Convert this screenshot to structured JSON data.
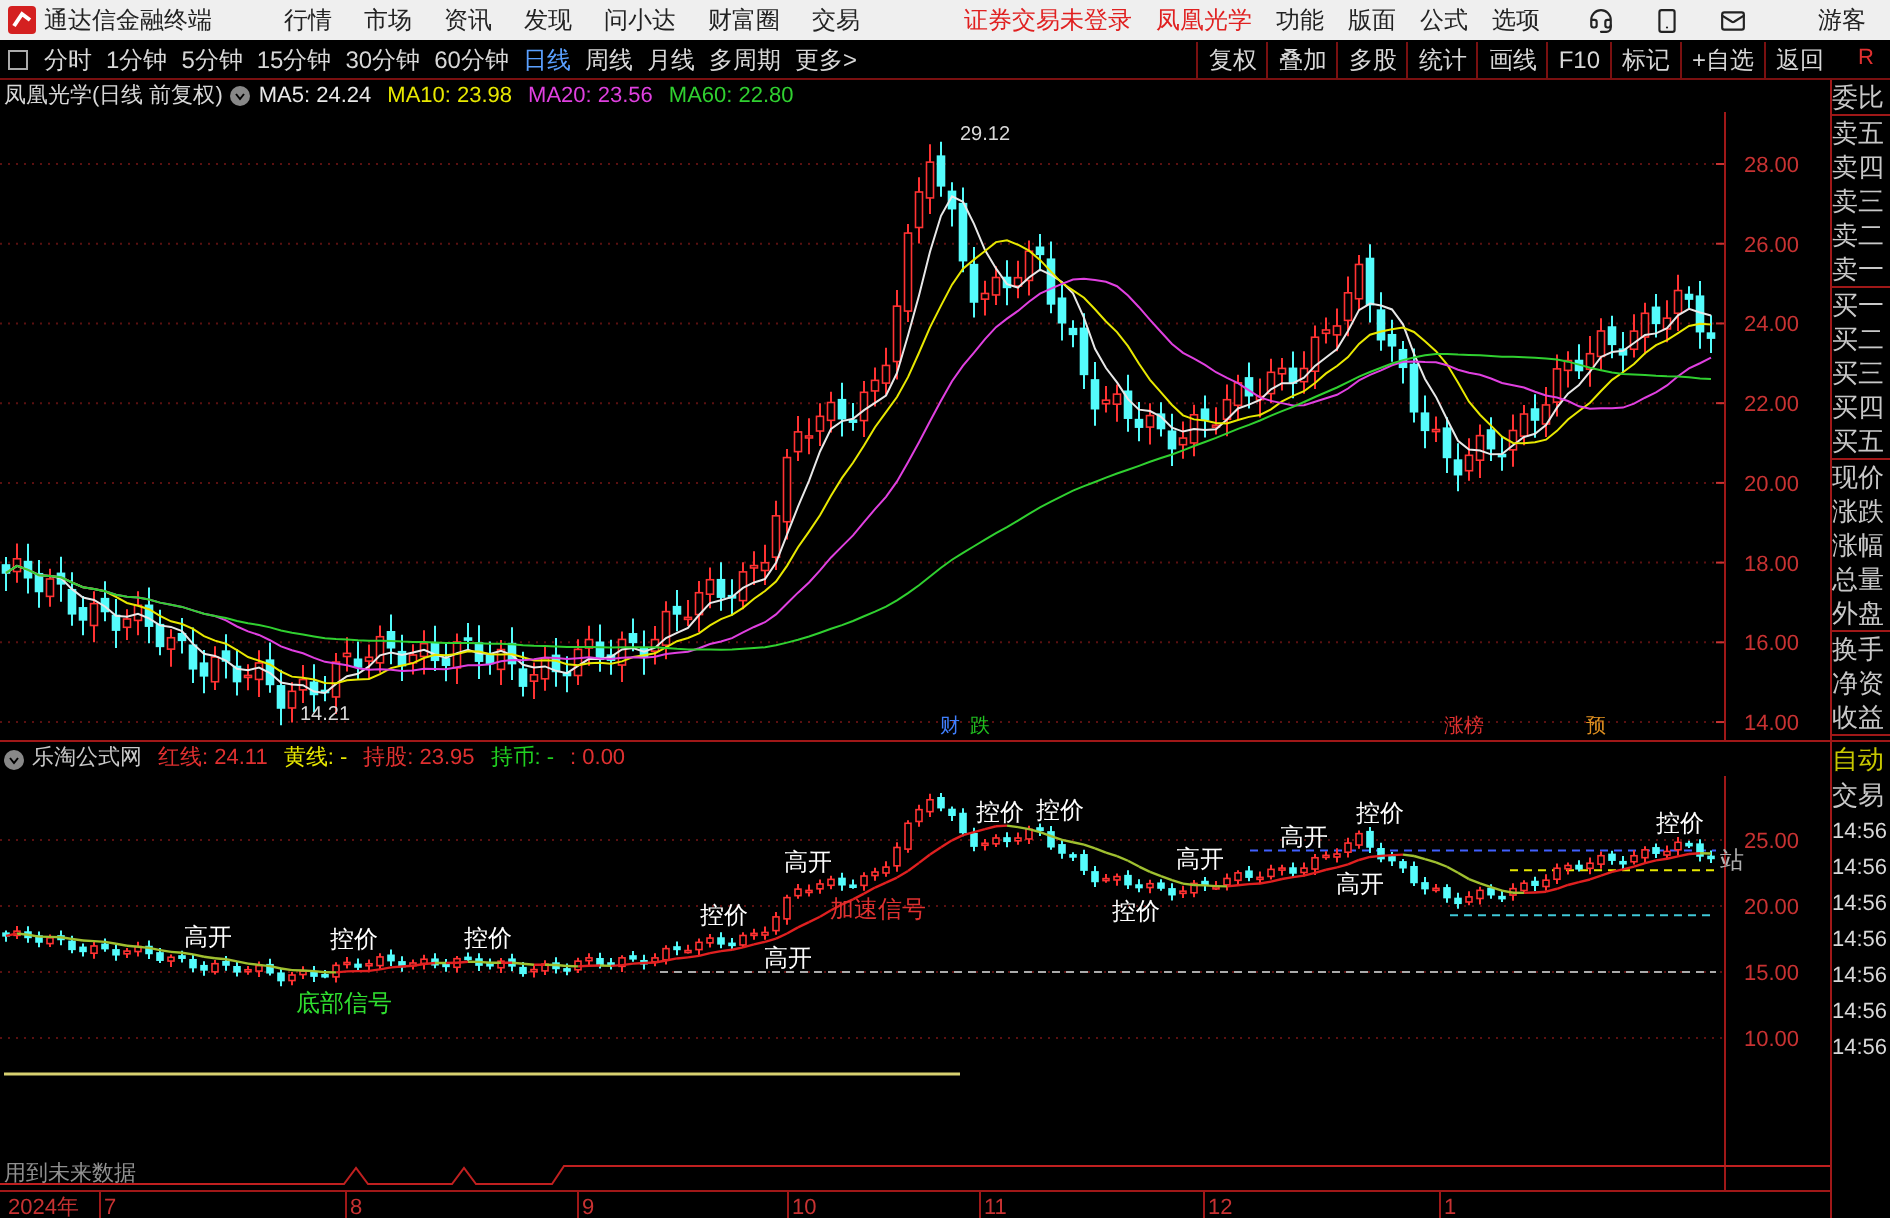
{
  "app_bar": {
    "title": "通达信金融终端",
    "menus": [
      "行情",
      "市场",
      "资讯",
      "发现",
      "问小达",
      "财富圈",
      "交易"
    ],
    "notices": [
      "证券交易未登录",
      "凤凰光学"
    ],
    "right_menus": [
      "功能",
      "版面",
      "公式",
      "选项"
    ],
    "user": "游客"
  },
  "toolbar": {
    "periods": [
      {
        "label": "分时",
        "selected": false
      },
      {
        "label": "1分钟",
        "selected": false
      },
      {
        "label": "5分钟",
        "selected": false
      },
      {
        "label": "15分钟",
        "selected": false
      },
      {
        "label": "30分钟",
        "selected": false
      },
      {
        "label": "60分钟",
        "selected": false
      },
      {
        "label": "日线",
        "selected": true
      },
      {
        "label": "周线",
        "selected": false
      },
      {
        "label": "月线",
        "selected": false
      },
      {
        "label": "多周期",
        "selected": false
      },
      {
        "label": "更多>",
        "selected": false
      }
    ],
    "buttons": [
      "复权",
      "叠加",
      "多股",
      "统计",
      "画线",
      "F10",
      "标记",
      "+自选",
      "返回"
    ],
    "corner": "R"
  },
  "price_chart": {
    "title": "凤凰光学(日线 前复权)",
    "mas": [
      {
        "text": "MA5: 24.24",
        "color": "#e8e8e8"
      },
      {
        "text": "MA10: 23.98",
        "color": "#e8e800"
      },
      {
        "text": "MA20: 23.56",
        "color": "#e040e0"
      },
      {
        "text": "MA60: 22.80",
        "color": "#30d030"
      }
    ],
    "y_labels": [
      "28.00",
      "26.00",
      "24.00",
      "22.00",
      "20.00",
      "18.00",
      "16.00",
      "14.00"
    ],
    "high_label": "29.12",
    "low_label": "14.21",
    "events": [
      {
        "text": "财",
        "color": "#4080ff"
      },
      {
        "text": "跌",
        "color": "#20c020"
      },
      {
        "text": "涨榜",
        "color": "#e03030"
      },
      {
        "text": "预",
        "color": "#e09020"
      }
    ]
  },
  "indicator_panel": {
    "title": "乐淘公式网",
    "values": [
      {
        "text": "红线: 24.11",
        "color": "#e03030"
      },
      {
        "text": "黄线: -",
        "color": "#e8e800"
      },
      {
        "text": "持股: 23.95",
        "color": "#e03030"
      },
      {
        "text": "持币: -",
        "color": "#20d020"
      },
      {
        "text": ": 0.00",
        "color": "#e03030"
      }
    ],
    "y_labels": [
      "25.00",
      "20.00",
      "15.00",
      "10.00"
    ],
    "signals": [
      {
        "text": "高开",
        "color": "#ffffff"
      },
      {
        "text": "底部信号",
        "color": "#30e030"
      },
      {
        "text": "控价",
        "color": "#ffffff"
      },
      {
        "text": "控价",
        "color": "#ffffff"
      },
      {
        "text": "控价",
        "color": "#ffffff"
      },
      {
        "text": "高开",
        "color": "#ffffff"
      },
      {
        "text": "高开",
        "color": "#ffffff"
      },
      {
        "text": "加速信号",
        "color": "#e03030"
      },
      {
        "text": "控价",
        "color": "#ffffff"
      },
      {
        "text": "控价",
        "color": "#ffffff"
      },
      {
        "text": "控价",
        "color": "#ffffff"
      },
      {
        "text": "高开",
        "color": "#ffffff"
      },
      {
        "text": "高开",
        "color": "#ffffff"
      },
      {
        "text": "控价",
        "color": "#ffffff"
      },
      {
        "text": "高开",
        "color": "#ffffff"
      },
      {
        "text": "控价",
        "color": "#ffffff"
      },
      {
        "text": "站",
        "color": "#b0b0b0"
      }
    ],
    "note": "用到未来数据"
  },
  "date_axis": [
    "2024年",
    "7",
    "8",
    "9",
    "10",
    "11",
    "12",
    "1"
  ],
  "quote_sidebar": {
    "groups": [
      [
        "委比"
      ],
      [
        "卖五",
        "卖四",
        "卖三",
        "卖二",
        "卖一"
      ],
      [
        "买一",
        "买二",
        "买三",
        "买四",
        "买五"
      ],
      [
        "现价",
        "涨跌",
        "涨幅",
        "总量",
        "外盘"
      ],
      [
        "换手",
        "净资",
        "收益"
      ]
    ]
  },
  "trade_sidebar": {
    "buttons": [
      "自动",
      "交易"
    ],
    "times": [
      "14:56",
      "14:56",
      "14:56",
      "14:56",
      "14:56",
      "14:56",
      "14:56"
    ]
  }
}
